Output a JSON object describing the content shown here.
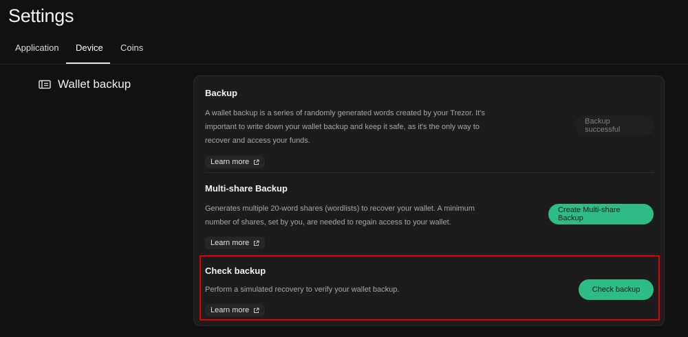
{
  "header": {
    "title": "Settings"
  },
  "tabs": [
    {
      "label": "Application",
      "active": false
    },
    {
      "label": "Device",
      "active": true
    },
    {
      "label": "Coins",
      "active": false
    }
  ],
  "section": {
    "title": "Wallet backup",
    "icon": "wallet-icon"
  },
  "rows": [
    {
      "title": "Backup",
      "description": "A wallet backup is a series of randomly generated words created by your Trezor. It's important to write down your wallet backup and keep it safe, as it's the only way to recover and access your funds.",
      "learn_more": "Learn more",
      "action_label": "Backup successful",
      "action_state": "disabled"
    },
    {
      "title": "Multi-share Backup",
      "description": "Generates multiple 20-word shares (wordlists) to recover your wallet. A minimum number of shares, set by you, are needed to regain access to your wallet.",
      "learn_more": "Learn more",
      "action_label": "Create Multi-share Backup",
      "action_state": "enabled"
    },
    {
      "title": "Check backup",
      "description": "Perform a simulated recovery to verify your wallet backup.",
      "learn_more": "Learn more",
      "action_label": "Check backup",
      "action_state": "enabled"
    }
  ],
  "colors": {
    "accent": "#2dbd84",
    "highlight": "#e00000",
    "background": "#111111",
    "card": "#1c1c1c"
  }
}
